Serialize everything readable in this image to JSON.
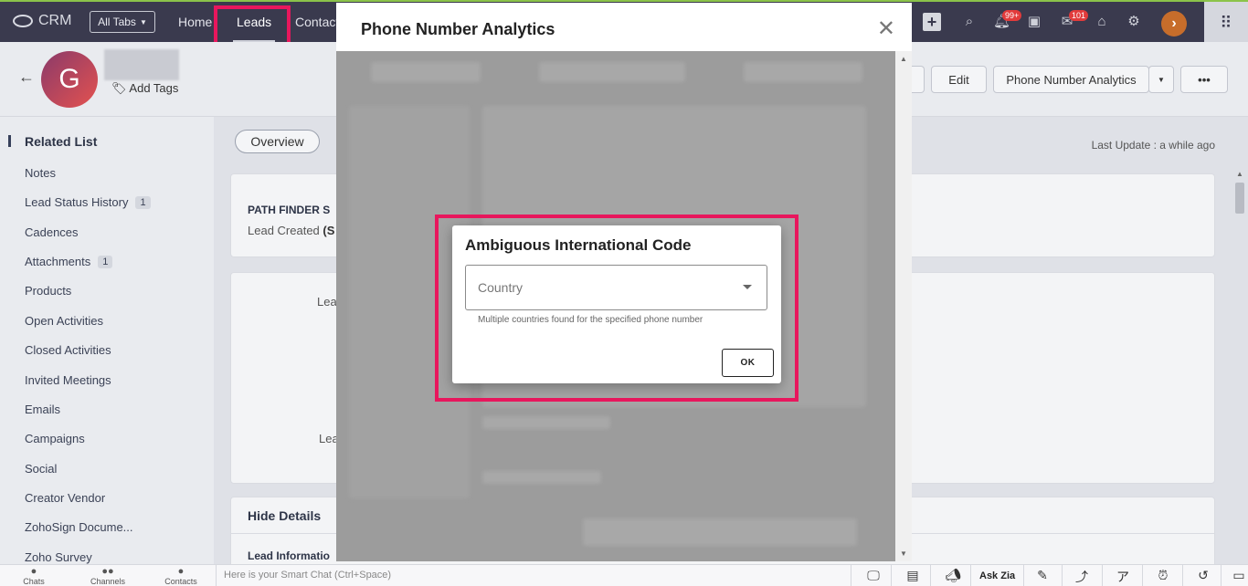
{
  "topnav": {
    "brand": "CRM",
    "all_tabs": "All Tabs",
    "tabs": [
      "Home",
      "Leads",
      "Contacts"
    ],
    "notifications_badge": "99+",
    "mail_badge": "101"
  },
  "header": {
    "avatar_letter": "G",
    "add_tags": "Add Tags",
    "edit_button": "Edit",
    "phone_analytics_button": "Phone Number Analytics",
    "more_button": "•••"
  },
  "sidebar": {
    "title": "Related List",
    "items": [
      {
        "label": "Notes",
        "count": ""
      },
      {
        "label": "Lead Status History",
        "count": "1"
      },
      {
        "label": "Cadences",
        "count": ""
      },
      {
        "label": "Attachments",
        "count": "1"
      },
      {
        "label": "Products",
        "count": ""
      },
      {
        "label": "Open Activities",
        "count": ""
      },
      {
        "label": "Closed Activities",
        "count": ""
      },
      {
        "label": "Invited Meetings",
        "count": ""
      },
      {
        "label": "Emails",
        "count": ""
      },
      {
        "label": "Campaigns",
        "count": ""
      },
      {
        "label": "Social",
        "count": ""
      },
      {
        "label": "Creator Vendor",
        "count": ""
      },
      {
        "label": "ZohoSign Docume...",
        "count": ""
      },
      {
        "label": "Zoho Survey",
        "count": ""
      }
    ]
  },
  "main": {
    "overview_tab": "Overview",
    "last_update": "Last Update : a while ago",
    "path_finder": "PATH FINDER S",
    "lead_created": "Lead Created",
    "lead_created_suffix": "(S",
    "lead_label_1": "Lea",
    "lead_label_2": "Lea",
    "hide_details": "Hide Details",
    "lead_information": "Lead Informatio"
  },
  "panel": {
    "title": "Phone Number Analytics",
    "close_glyph": "✕"
  },
  "dialog": {
    "title": "Ambiguous International Code",
    "select_placeholder": "Country",
    "helper_text": "Multiple countries found for the specified phone number",
    "ok_button": "OK"
  },
  "bottombar": {
    "chats": "Chats",
    "channels": "Channels",
    "contacts": "Contacts",
    "smart_chat_placeholder": "Here is your Smart Chat (Ctrl+Space)",
    "ask_zia": "Ask Zia"
  },
  "colors": {
    "highlight": "#e8175d",
    "topnav_bg": "#3a3a4e"
  }
}
